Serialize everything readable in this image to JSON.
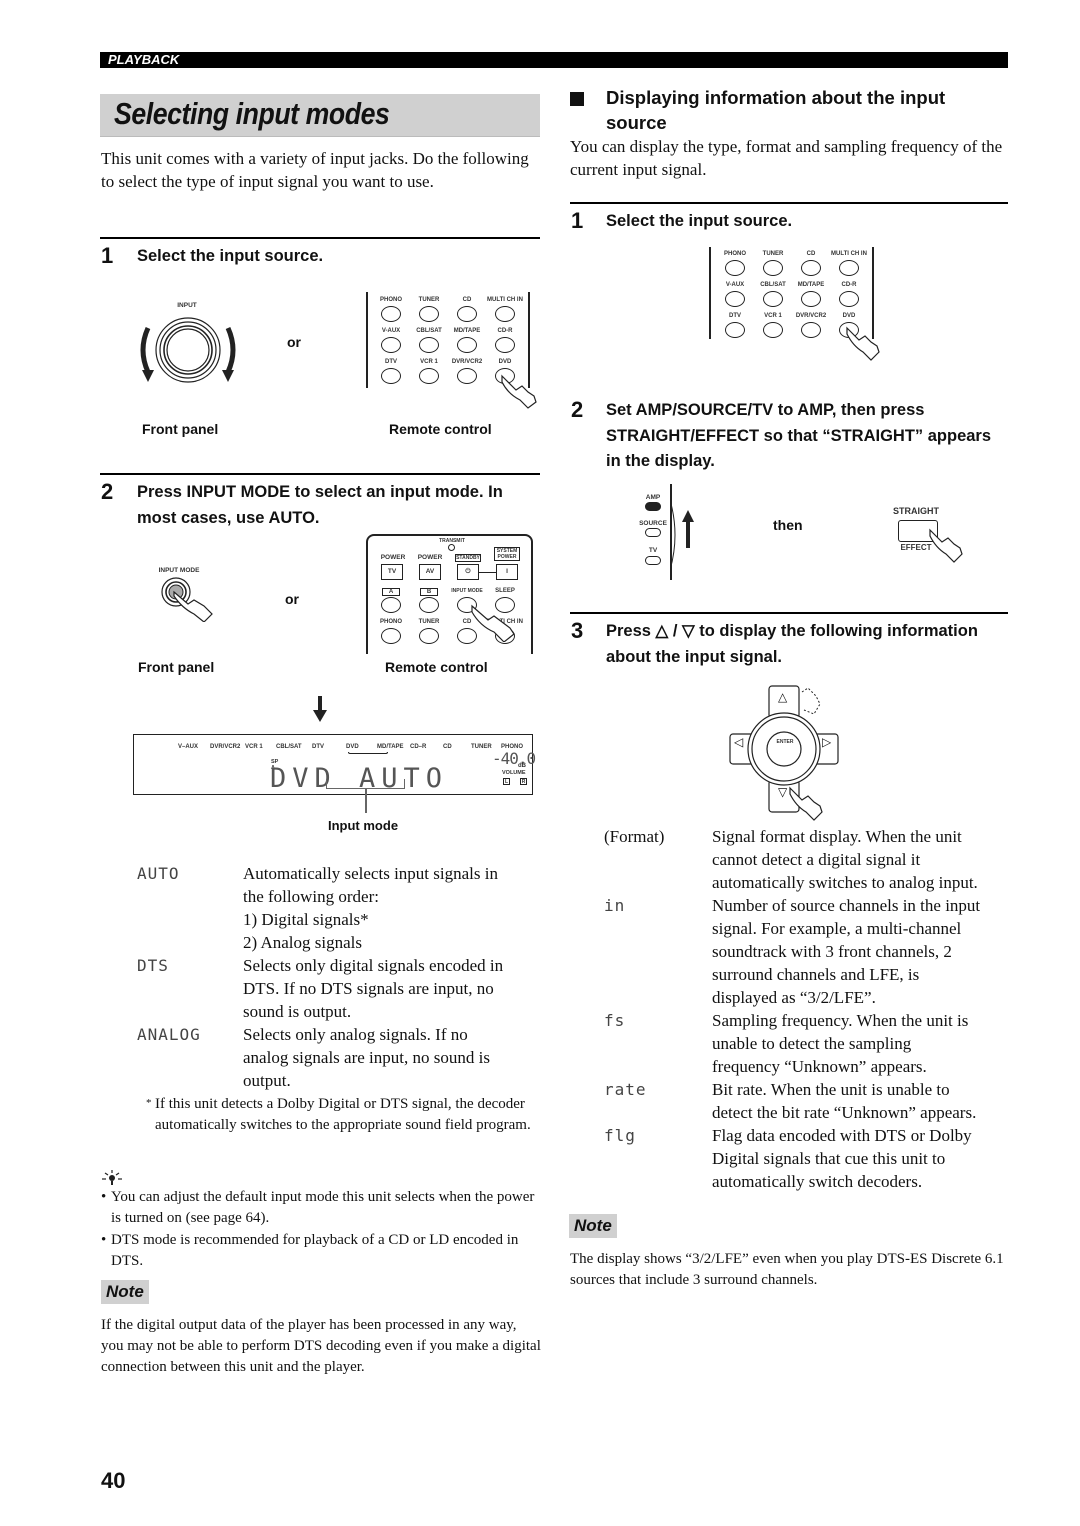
{
  "header": {
    "section_label": "PLAYBACK"
  },
  "left": {
    "title": "Selecting input modes",
    "intro": "This unit comes with a variety of input jacks. Do the following to select the type of input signal you want to use.",
    "step1": {
      "number": "1",
      "text": "Select the input source.",
      "front_panel_knob_label": "INPUT",
      "or_label": "or",
      "front_panel_caption": "Front panel",
      "remote_caption": "Remote control",
      "remote_buttons": [
        "PHONO",
        "TUNER",
        "CD",
        "MULTI CH IN",
        "V-AUX",
        "CBL/SAT",
        "MD/TAPE",
        "CD-R",
        "DTV",
        "VCR 1",
        "DVR/VCR2",
        "DVD"
      ]
    },
    "step2": {
      "number": "2",
      "text": "Press INPUT MODE to select an input mode. In most cases, use AUTO.",
      "front_panel_button_label": "INPUT MODE",
      "or_label": "or",
      "front_panel_caption": "Front panel",
      "remote_caption": "Remote control",
      "remote": {
        "transmit": "TRANSMIT",
        "power_tv_label": "POWER",
        "power_tv_button": "TV",
        "power_av_label": "POWER",
        "power_av_button": "AV",
        "standby_label": "STANDBY",
        "standby_button": "⏻",
        "system_power_label": "SYSTEM POWER",
        "system_power_button": "I",
        "row2": [
          "A",
          "B",
          "INPUT MODE",
          "SLEEP"
        ],
        "row3": [
          "PHONO",
          "TUNER",
          "CD",
          "MULTI CH IN"
        ]
      }
    },
    "display": {
      "sources": [
        "V–AUX",
        "DVR/VCR2",
        "VCR 1",
        "CBL/SAT",
        "DTV",
        "DVD",
        "MD/TAPE",
        "CD–R",
        "CD",
        "TUNER",
        "PHONO"
      ],
      "selected_source": "DVD",
      "sp_indicator": "SP A",
      "main_text": "DVD AUTO",
      "volume": "-40.0",
      "volume_unit": "dB",
      "volume_label": "VOLUME",
      "left_indicator": "L",
      "right_indicator": "R",
      "pointer_caption": "Input mode"
    },
    "modes": [
      {
        "term": "AUTO",
        "desc_lines": [
          "Automatically selects input signals in",
          "the following order:",
          "1) Digital signals*",
          "2) Analog signals"
        ]
      },
      {
        "term": "DTS",
        "desc_lines": [
          "Selects only digital signals encoded in",
          "DTS. If no DTS signals are input, no",
          "sound is output."
        ]
      },
      {
        "term": "ANALOG",
        "desc_lines": [
          "Selects only analog signals. If no",
          "analog signals are input, no sound is",
          "output."
        ]
      }
    ],
    "footnote_mark": "*",
    "footnote": "If this unit detects a Dolby Digital or DTS signal, the decoder automatically switches to the appropriate sound field program.",
    "tips": [
      "You can adjust the default input mode this unit selects when the power is turned on (see page 64).",
      "DTS mode is recommended for playback of a CD or LD encoded in DTS."
    ],
    "note_label": "Note",
    "note": "If the digital output data of the player has been processed in any way, you may not be able to perform DTS decoding even if you make a digital connection between this unit and the player."
  },
  "right": {
    "heading": "Displaying information about the input source",
    "intro": "You can display the type, format and sampling frequency of the current input signal.",
    "step1": {
      "number": "1",
      "text": "Select the input source.",
      "remote_buttons": [
        "PHONO",
        "TUNER",
        "CD",
        "MULTI CH IN",
        "V-AUX",
        "CBL/SAT",
        "MD/TAPE",
        "CD-R",
        "DTV",
        "VCR 1",
        "DVR/VCR2",
        "DVD"
      ]
    },
    "step2": {
      "number": "2",
      "text": "Set AMP/SOURCE/TV to AMP, then press STRAIGHT/EFFECT so that “STRAIGHT” appears in the display.",
      "switch_labels": [
        "AMP",
        "SOURCE",
        "TV"
      ],
      "then_label": "then",
      "straight_label": "STRAIGHT",
      "effect_label": "EFFECT"
    },
    "step3": {
      "number": "3",
      "text": "Press △ / ▽ to display the following information about the input signal.",
      "enter_label": "ENTER",
      "up": "△",
      "down": "▽",
      "left": "◁",
      "right": "▷"
    },
    "info_items": [
      {
        "term": "(Format)",
        "desc_lines": [
          "Signal format display. When the unit",
          "cannot detect a digital signal it",
          "automatically switches to analog input."
        ]
      },
      {
        "term": "in",
        "desc_lines": [
          "Number of source channels in the input",
          "signal. For example, a multi-channel",
          "soundtrack with 3 front channels, 2",
          "surround channels and LFE, is",
          "displayed as “3/2/LFE”."
        ]
      },
      {
        "term": "fs",
        "desc_lines": [
          "Sampling frequency. When the unit is",
          "unable to detect the sampling",
          "frequency “Unknown” appears."
        ]
      },
      {
        "term": "rate",
        "desc_lines": [
          "Bit rate. When the unit is unable to",
          "detect the bit rate “Unknown” appears."
        ]
      },
      {
        "term": "flg",
        "desc_lines": [
          "Flag data encoded with DTS or Dolby",
          "Digital signals that cue this unit to",
          "automatically switch decoders."
        ]
      }
    ],
    "note_label": "Note",
    "note": "The display shows “3/2/LFE” even when you play DTS-ES Discrete 6.1 sources that include 3 surround channels."
  },
  "page_number": "40"
}
